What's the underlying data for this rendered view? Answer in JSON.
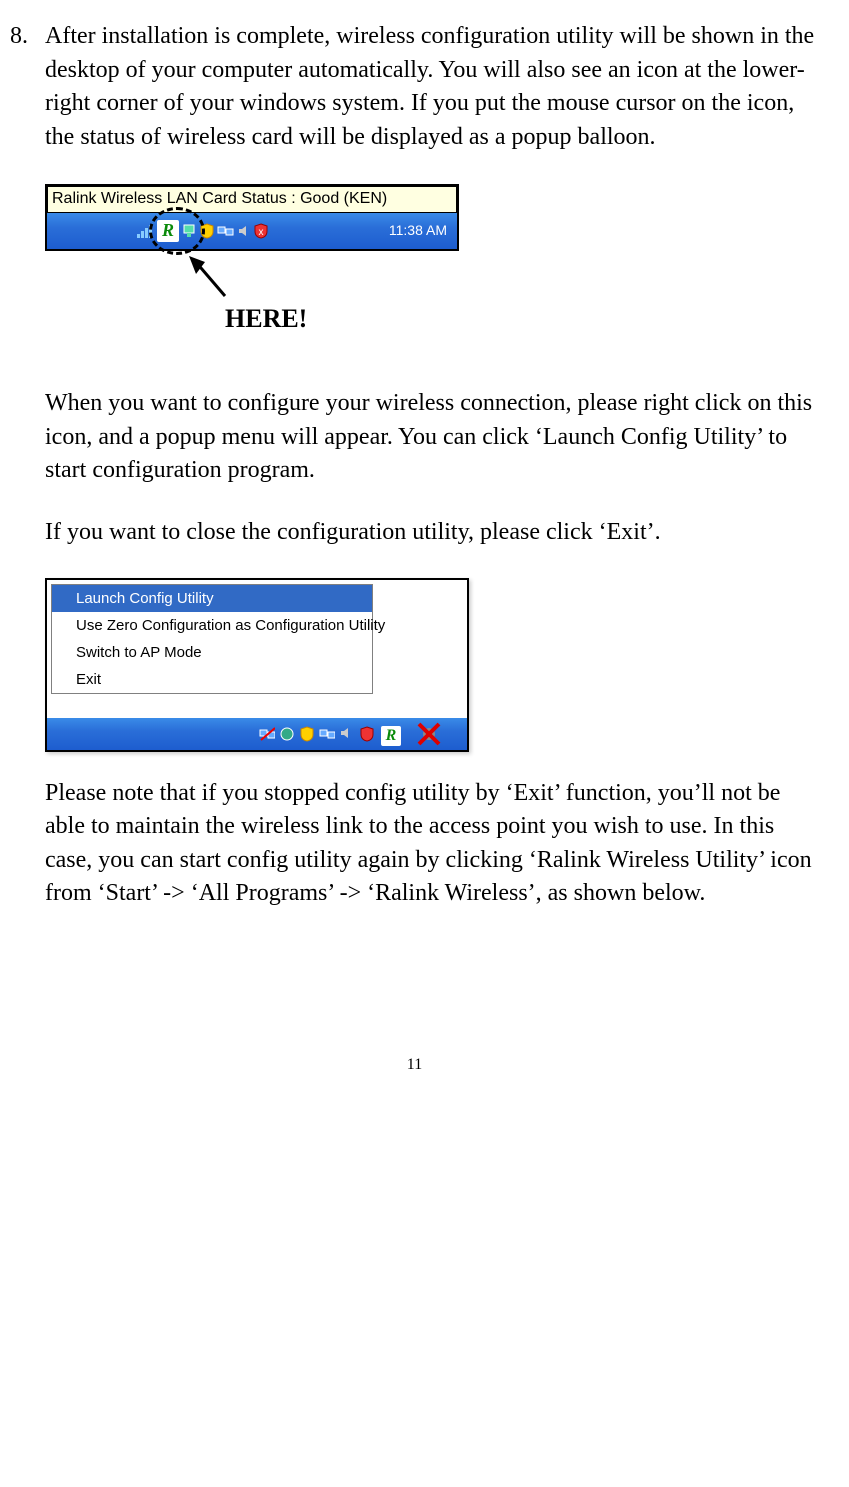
{
  "step": {
    "number": "8.",
    "para1": "After installation is complete, wireless configuration utility will be shown in the desktop of your computer automatically. You will also see an icon at the lower-right corner of your windows system. If you put the mouse cursor on the icon, the status of wireless card will be displayed as a popup balloon.",
    "para2": "When you want to configure your wireless connection, please right click on this icon, and a popup menu will appear. You can click ‘Launch Config Utility’ to start configuration program.",
    "para3": "If you want to close the configuration utility, please click ‘Exit’.",
    "para4": "Please note that if you stopped config utility by ‘Exit’ function, you’ll not be able to maintain the wireless link to the access point you wish to use. In this case, you can start config utility again by clicking ‘Ralink Wireless Utility’ icon from ‘Start’ -> ‘All Programs’ -> ‘Ralink Wireless’, as shown below."
  },
  "figure1": {
    "tooltip": "Ralink Wireless LAN Card Status : Good (KEN)",
    "ralink_letter": "R",
    "clock": "11:38 AM",
    "arrow_label": "HERE!"
  },
  "figure2": {
    "menu_items": [
      {
        "label": "Launch Config Utility",
        "highlighted": true
      },
      {
        "label": "Use Zero Configuration as Configuration Utility",
        "highlighted": false
      },
      {
        "label": "Switch to AP Mode",
        "highlighted": false
      },
      {
        "label": "Exit",
        "highlighted": false
      }
    ]
  },
  "page_number": "11"
}
